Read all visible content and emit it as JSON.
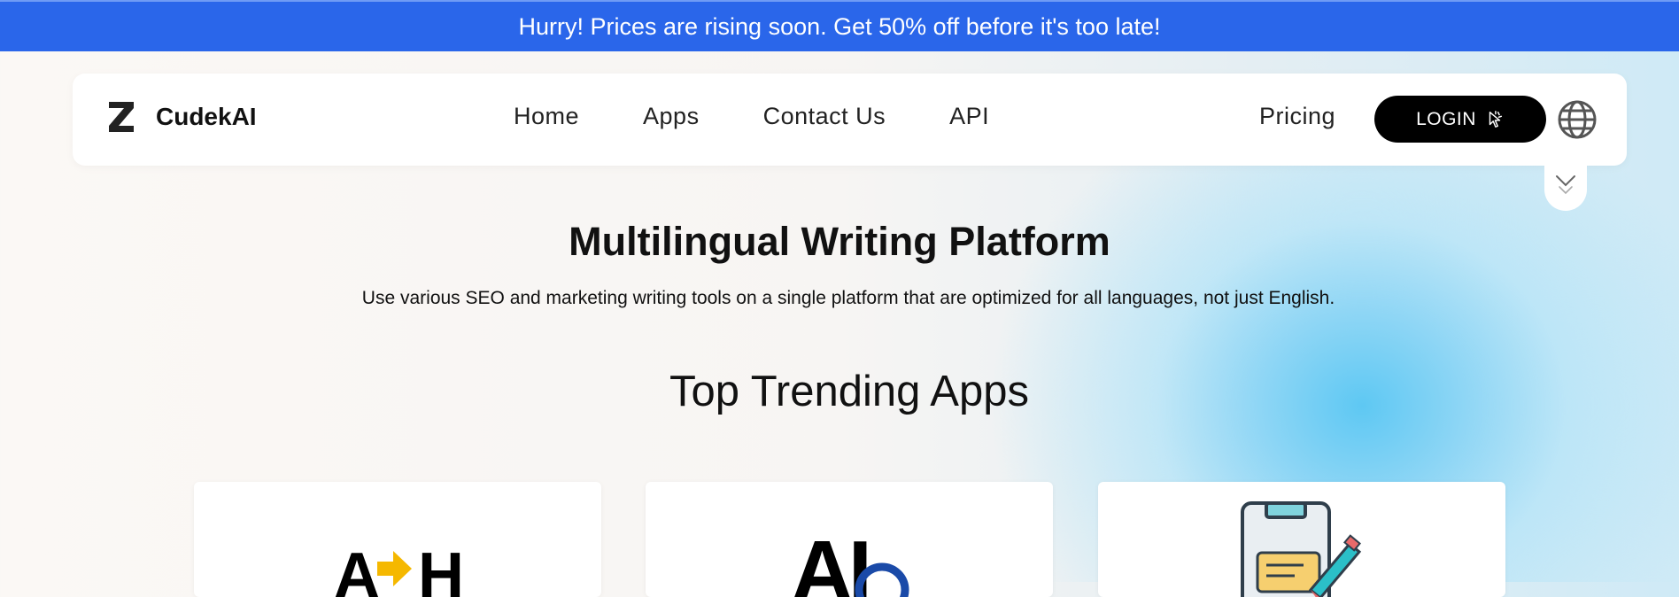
{
  "banner": {
    "text": "Hurry! Prices are rising soon. Get 50% off before it's too late!"
  },
  "nav": {
    "brand": "CudekAI",
    "links": [
      "Home",
      "Apps",
      "Contact Us",
      "API"
    ],
    "pricing": "Pricing",
    "login": "LOGIN"
  },
  "hero": {
    "title": "Multilingual Writing Platform",
    "subtitle": "Use various SEO and marketing writing tools on a single platform that are optimized for all languages, not just English."
  },
  "trending": {
    "heading": "Top Trending Apps"
  },
  "cards": [
    {
      "icon": "text-conversion-icon",
      "glyph_left": "A",
      "glyph_right": "H"
    },
    {
      "icon": "ai-detector-icon",
      "glyph": "AI"
    },
    {
      "icon": "clipboard-edit-icon"
    }
  ],
  "colors": {
    "banner_bg": "#2a66ea",
    "login_bg": "#000000",
    "accent_yellow": "#f5b800",
    "accent_blue": "#1a4aa8",
    "accent_teal": "#2bbfc8"
  }
}
